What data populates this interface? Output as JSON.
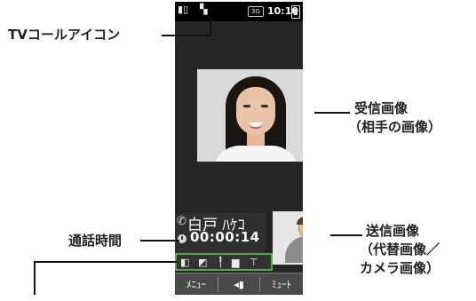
{
  "callouts": {
    "tv_call_icon": "TVコールアイコン",
    "received_image": [
      "受信画像",
      "（相手の画像）"
    ],
    "call_duration": "通話時間",
    "sent_image": [
      "送信画像",
      "（代替画像／",
      "カメラ画像）"
    ]
  },
  "status_bar": {
    "network": "3G",
    "time": "10:10"
  },
  "call": {
    "caller_name": "白戸 ﾊｹｺ",
    "duration": "00:00:14"
  },
  "softkeys": {
    "menu": "ﾒﾆｭｰ",
    "mute": "ﾐｭｰﾄ"
  },
  "colors": {
    "icon_highlight": "#58a548",
    "screen_bg": "#262626"
  }
}
